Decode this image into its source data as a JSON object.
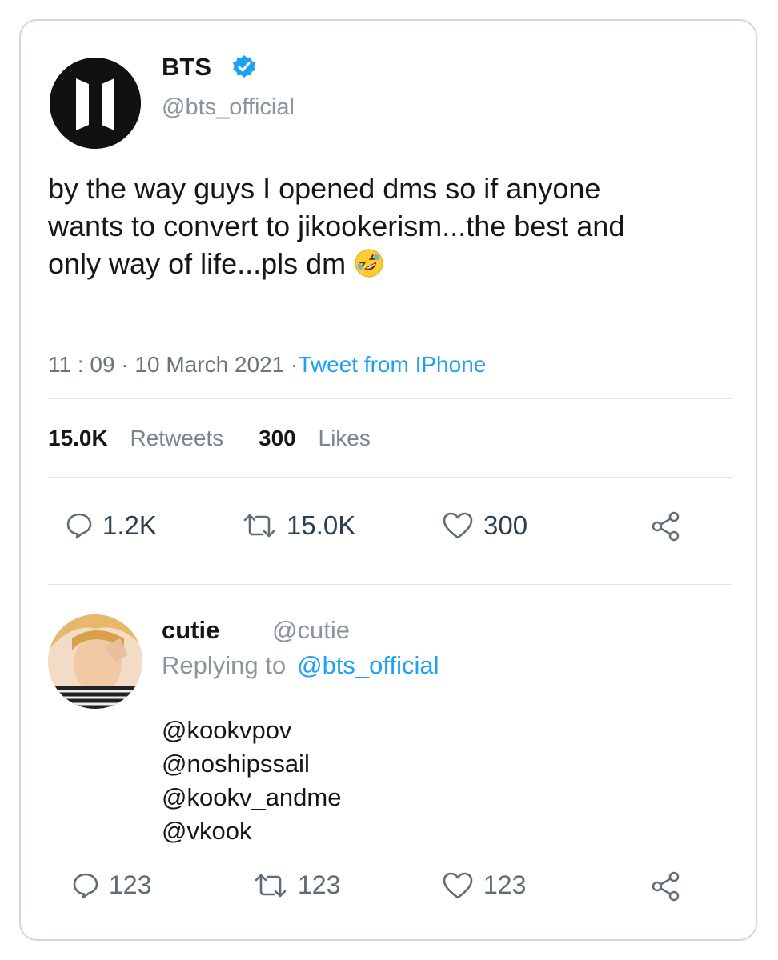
{
  "tweet": {
    "display_name": "BTS",
    "handle": "@bts_official",
    "avatar_text": "BTS",
    "text": "by the way guys I opened dms so if anyone wants to convert to jikookerism...the best and only way of life...pls dm",
    "emoji": "rolling-on-floor-laughing",
    "time": "11 : 09 · 10 March 2021 ·",
    "source": "Tweet from IPhone",
    "retweets_count": "15.0K",
    "retweets_label": "Retweets",
    "likes_count": "300",
    "likes_label": "Likes",
    "actions": {
      "reply": "1.2K",
      "retweet": "15.0K",
      "like": "300"
    }
  },
  "reply": {
    "display_name": "cutie",
    "handle": "@cutie",
    "replying_label": "Replying to",
    "replying_to": "@bts_official",
    "mentions": [
      "@kookvpov",
      "@noshipssail",
      "@kookv_andme",
      "@vkook"
    ],
    "actions": {
      "reply": "123",
      "retweet": "123",
      "like": "123"
    }
  },
  "colors": {
    "link": "#1da1f2",
    "verified": "#1da1f2",
    "muted": "#8a949c"
  }
}
